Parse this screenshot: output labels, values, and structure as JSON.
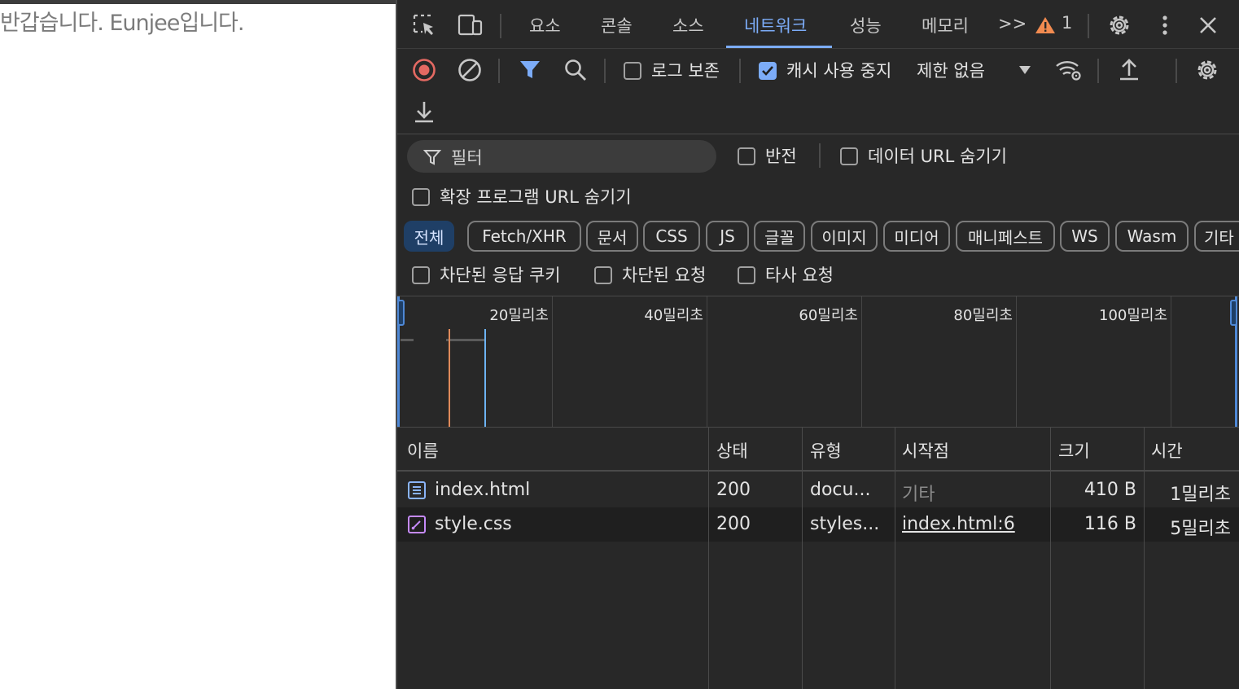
{
  "page": {
    "text": "반갑습니다. Eunjee입니다."
  },
  "devtools": {
    "tabs": [
      {
        "label": "요소"
      },
      {
        "label": "콘솔"
      },
      {
        "label": "소스"
      },
      {
        "label": "네트워크"
      },
      {
        "label": "성능"
      },
      {
        "label": "메모리"
      }
    ],
    "more_tabs": ">>",
    "warning_count": "1",
    "icons": {
      "inspect": "inspect-element-icon",
      "device": "device-toolbar-icon",
      "warning": "warning-icon",
      "settings": "settings-gear-icon",
      "more": "more-vertical-icon",
      "close": "close-icon"
    },
    "accent_color": "#7cacf8"
  },
  "network": {
    "toolbar": {
      "preserve_log": {
        "label": "로그 보존",
        "checked": false
      },
      "disable_cache": {
        "label": "캐시 사용 중지",
        "checked": true
      },
      "throttling": "제한 없음"
    },
    "filter": {
      "placeholder": "필터",
      "invert": "반전",
      "hide_data_urls": "데이터 URL 숨기기",
      "hide_extension_urls": "확장 프로그램 URL 숨기기"
    },
    "types": [
      "전체",
      "Fetch/XHR",
      "문서",
      "CSS",
      "JS",
      "글꼴",
      "이미지",
      "미디어",
      "매니페스트",
      "WS",
      "Wasm",
      "기타"
    ],
    "active_type": "전체",
    "more_filters": {
      "blocked_cookies": "차단된 응답 쿠키",
      "blocked_requests": "차단된 요청",
      "third_party": "타사 요청"
    },
    "overview": {
      "labels": [
        "20밀리초",
        "40밀리초",
        "60밀리초",
        "80밀리초",
        "100밀리초"
      ]
    },
    "table": {
      "headers": [
        "이름",
        "상태",
        "유형",
        "시작점",
        "크기",
        "시간"
      ],
      "rows": [
        {
          "name": "index.html",
          "status": "200",
          "type": "docu...",
          "initiator": "기타",
          "size": "410 B",
          "time": "1밀리초",
          "icon": "document-icon"
        },
        {
          "name": "style.css",
          "status": "200",
          "type": "styles...",
          "initiator": "index.html:6",
          "size": "116 B",
          "time": "5밀리초",
          "icon": "stylesheet-icon"
        }
      ]
    }
  }
}
